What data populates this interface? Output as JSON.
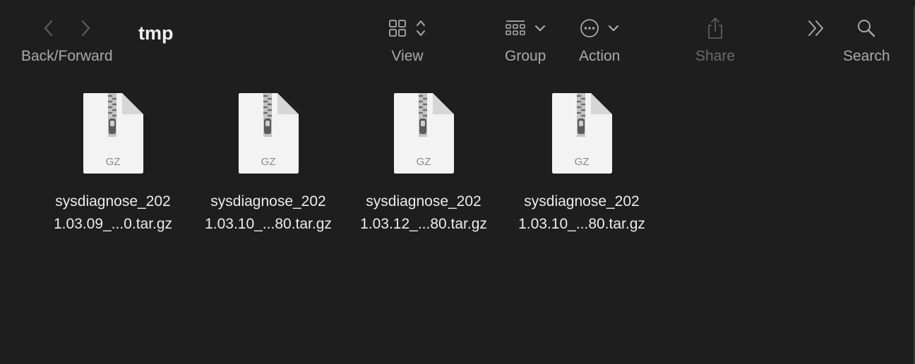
{
  "window": {
    "title": "tmp"
  },
  "toolbar": {
    "back_forward_label": "Back/Forward",
    "view_label": "View",
    "group_label": "Group",
    "action_label": "Action",
    "share_label": "Share",
    "search_label": "Search"
  },
  "icons": {
    "back": "chevron-left-icon",
    "forward": "chevron-right-icon",
    "view": "grid-icon",
    "group": "group-icon",
    "action": "ellipsis-circle-icon",
    "share": "share-icon",
    "more": "double-chevron-icon",
    "search": "magnifier-icon"
  },
  "files": [
    {
      "line1": "sysdiagnose_202",
      "line2": "1.03.09_...0.tar.gz",
      "badge": "GZ"
    },
    {
      "line1": "sysdiagnose_202",
      "line2": "1.03.10_...80.tar.gz",
      "badge": "GZ"
    },
    {
      "line1": "sysdiagnose_202",
      "line2": "1.03.12_...80.tar.gz",
      "badge": "GZ"
    },
    {
      "line1": "sysdiagnose_202",
      "line2": "1.03.10_...80.tar.gz",
      "badge": "GZ"
    }
  ],
  "colors": {
    "background": "#1e1e1e",
    "label": "#a9a9a9",
    "disabled": "#6a6a6a"
  }
}
